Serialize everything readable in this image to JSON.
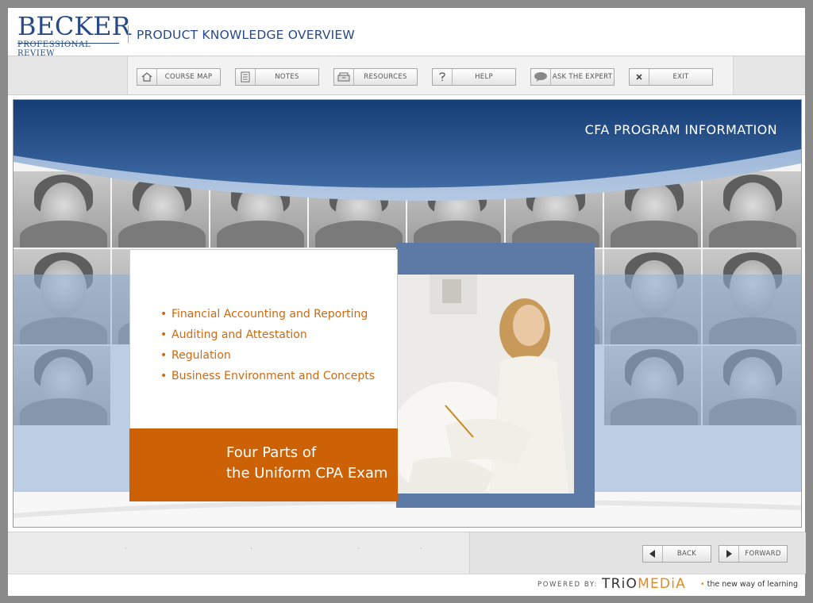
{
  "header": {
    "logo_word": "BECKER",
    "logo_sub": "PROFESSIONAL REVIEW",
    "title": "PRODUCT KNOWLEDGE OVERVIEW"
  },
  "toolbar": {
    "buttons": [
      {
        "label": "COURSE MAP",
        "icon": "home-icon"
      },
      {
        "label": "NOTES",
        "icon": "notes-icon"
      },
      {
        "label": "RESOURCES",
        "icon": "resources-icon"
      },
      {
        "label": "HELP",
        "icon": "help-icon"
      },
      {
        "label": "ASK THE EXPERT",
        "icon": "speech-bubble-icon"
      },
      {
        "label": "EXIT",
        "icon": "close-icon"
      }
    ]
  },
  "content": {
    "banner_title": "CFA PROGRAM INFORMATION",
    "bullets": [
      "Financial Accounting and Reporting",
      "Auditing and Attestation",
      "Regulation",
      "Business Environment and Concepts"
    ],
    "caption_line1": "Four Parts of",
    "caption_line2": "the Uniform CPA Exam"
  },
  "footer": {
    "back_label": "BACK",
    "forward_label": "FORWARD"
  },
  "powered": {
    "label": "POWERED BY:",
    "brand_a": "TRiO",
    "brand_b": "MEDiA",
    "tag_bullet": "•",
    "tag_text": "the new way of learning"
  },
  "colors": {
    "brand_blue": "#274a86",
    "accent_orange": "#cc6105",
    "banner_blue": "#1e4a82"
  }
}
